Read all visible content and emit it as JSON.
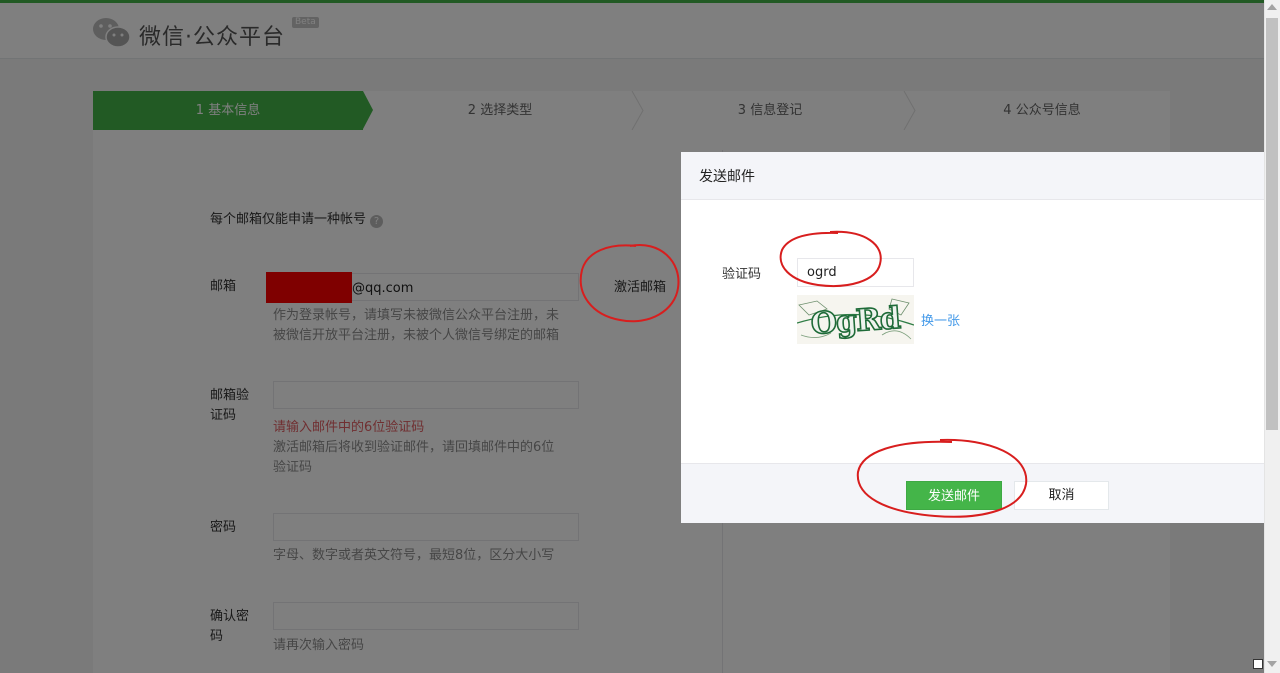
{
  "header": {
    "logo_text": "微信·公众平台",
    "beta": "Beta"
  },
  "steps": [
    "1 基本信息",
    "2 选择类型",
    "3 信息登记",
    "4 公众号信息"
  ],
  "form": {
    "tip": "每个邮箱仅能申请一种帐号",
    "help_icon": "?",
    "email_label": "邮箱",
    "email_suffix": "@qq.com",
    "activate_label": "激活邮箱",
    "email_hint": "作为登录帐号，请填写未被微信公众平台注册，未被微信开放平台注册，未被个人微信号绑定的邮箱",
    "code_label": "邮箱验证码",
    "code_error": "请输入邮件中的6位验证码",
    "code_hint": "激活邮箱后将收到验证邮件，请回填邮件中的6位验证码",
    "password_label": "密码",
    "password_hint": "字母、数字或者英文符号，最短8位，区分大小写",
    "confirm_label": "确认密码",
    "confirm_hint": "请再次输入密码"
  },
  "dialog": {
    "title": "发送邮件",
    "captcha_label": "验证码",
    "captcha_value": "ogrd",
    "captcha_image_text": "OgRd",
    "refresh_label": "换一张",
    "send_label": "发送邮件",
    "cancel_label": "取消"
  },
  "colors": {
    "brand_green": "#44b549",
    "link_blue": "#459ae9",
    "error_red": "#e15f63",
    "annotation_red": "#d81e1e"
  }
}
